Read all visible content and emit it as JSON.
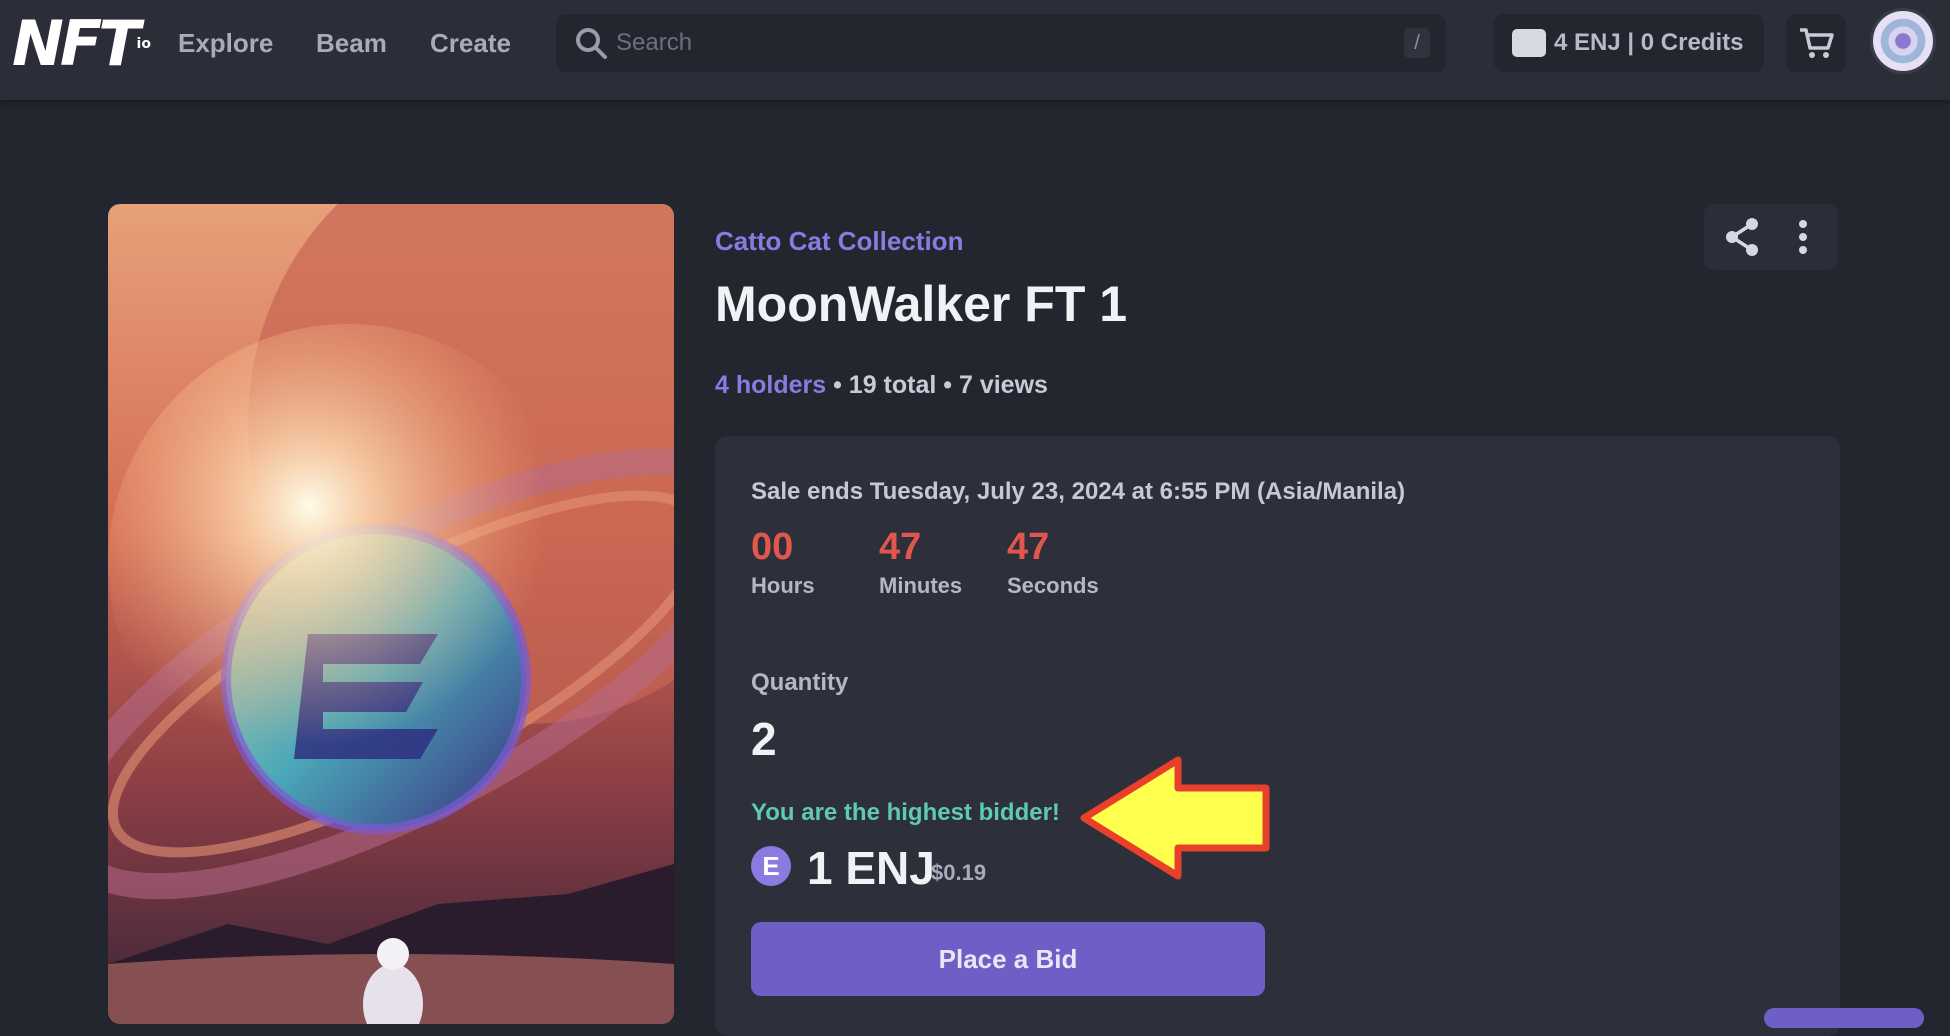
{
  "header": {
    "logo": "NFT",
    "logo_suffix": "io",
    "nav": [
      {
        "label": "Explore"
      },
      {
        "label": "Beam"
      },
      {
        "label": "Create"
      }
    ],
    "search": {
      "placeholder": "Search",
      "shortcut": "/"
    },
    "wallet": {
      "label": "4 ENJ | 0 Credits"
    }
  },
  "item": {
    "collection": "Catto Cat Collection",
    "title": "MoonWalker FT 1",
    "holders": "4 holders",
    "stats_rest": " • 19 total • 7 views"
  },
  "sale": {
    "ends_text": "Sale ends Tuesday, July 23, 2024 at 6:55 PM (Asia/Manila)",
    "countdown": [
      {
        "value": "00",
        "label": "Hours"
      },
      {
        "value": "47",
        "label": "Minutes"
      },
      {
        "value": "47",
        "label": "Seconds"
      }
    ],
    "quantity_label": "Quantity",
    "quantity_value": "2",
    "bid_status": "You are the highest bidder!",
    "price": "1 ENJ",
    "price_usd": "$0.19",
    "token_symbol": "E",
    "bid_button": "Place a Bid"
  },
  "colors": {
    "accent": "#6e5fc6",
    "link": "#8b7be0",
    "countdown": "#e2574c",
    "success": "#5ec9b5",
    "callout_fill": "#ffff4d",
    "callout_stroke": "#e8402b"
  },
  "icons": [
    "search-icon",
    "wallet-icon",
    "cart-icon",
    "share-icon",
    "more-vertical-icon",
    "enj-token-icon",
    "arrow-callout"
  ]
}
